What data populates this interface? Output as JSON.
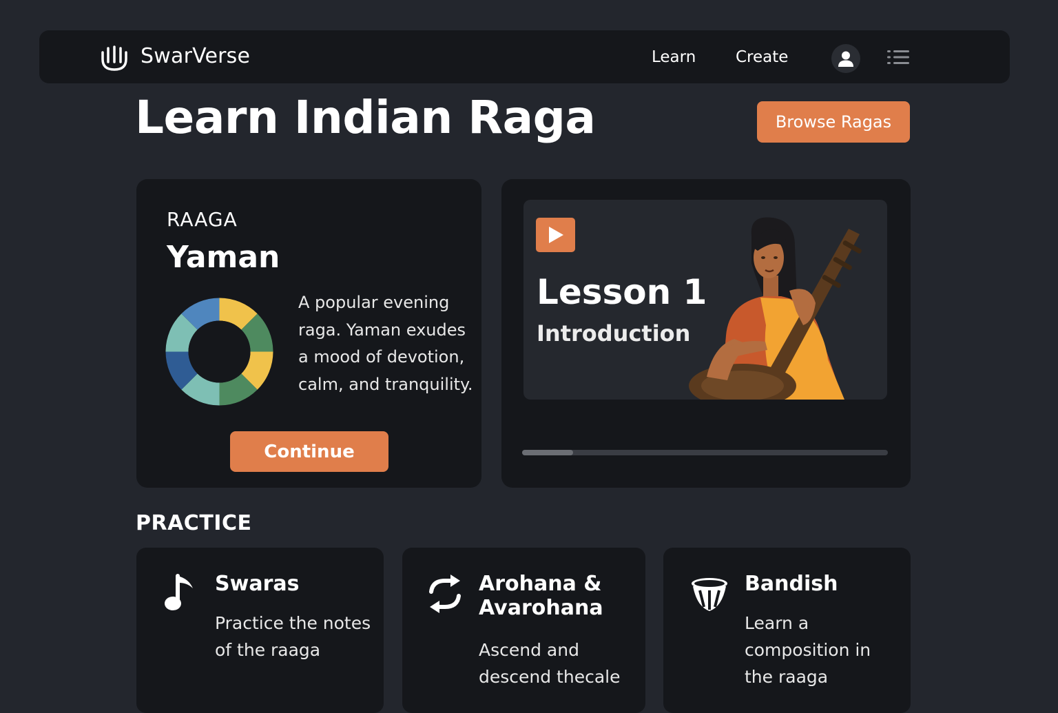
{
  "app": {
    "name": "SwarVerse"
  },
  "nav": {
    "learn_label": "Learn",
    "create_label": "Create"
  },
  "page": {
    "title": "Learn Indian Raga",
    "browse_label": "Browse Ragas"
  },
  "raga_card": {
    "label": "RAAGA",
    "name": "Yaman",
    "description": "A popular evening raga. Yaman exudes a mood of devotion, calm, and tranquility.",
    "continue_label": "Continue",
    "segment_colors": [
      "#f0c24b",
      "#4e8a5f",
      "#f0c24b",
      "#4e8a5f",
      "#7ebfb4",
      "#2f5c94",
      "#7ebfb4",
      "#4f86be"
    ]
  },
  "lesson_card": {
    "title": "Lesson 1",
    "subtitle": "Introduction",
    "progress": 0.14
  },
  "practice": {
    "heading": "PRACTICE",
    "cards": [
      {
        "title": "Swaras",
        "description": "Practice the notes of the raaga",
        "icon": "music-note-icon"
      },
      {
        "title": "Arohana & Avarohana",
        "description": "Ascend and descend thecale",
        "icon": "repeat-arrows-icon"
      },
      {
        "title": "Bandish",
        "description": "Learn a composition in the raaga",
        "icon": "drum-icon"
      }
    ]
  },
  "colors": {
    "accent": "#e07e4b",
    "background": "#23262d",
    "card": "#15171b"
  }
}
